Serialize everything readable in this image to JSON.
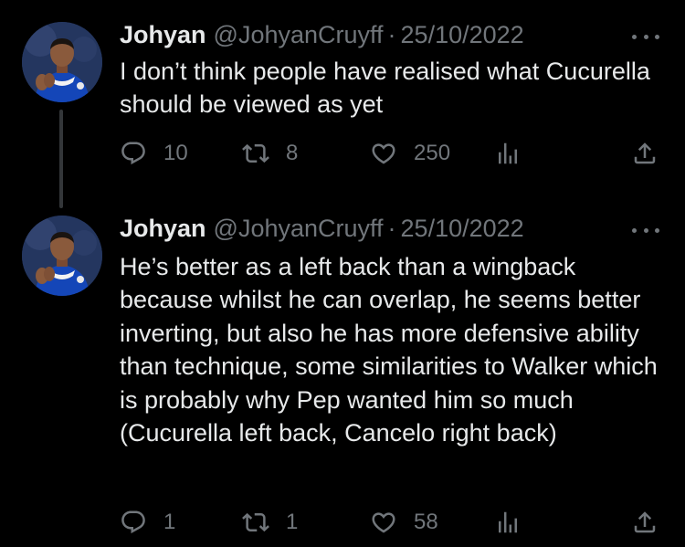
{
  "colors": {
    "background": "#000000",
    "text_primary": "#e7e9ea",
    "text_secondary": "#71767b",
    "thread_line": "#333639"
  },
  "icons": {
    "reply": "reply-icon",
    "retweet": "retweet-icon",
    "like": "heart-icon",
    "views": "analytics-icon",
    "share": "share-icon",
    "more": "more-icon"
  },
  "tweets": [
    {
      "name": "Johyan",
      "handle": "@JohyanCruyff",
      "separator": "·",
      "date": "25/10/2022",
      "text": "I don’t think people have realised what Cucurella should be viewed as yet",
      "replies": "10",
      "retweets": "8",
      "likes": "250"
    },
    {
      "name": "Johyan",
      "handle": "@JohyanCruyff",
      "separator": "·",
      "date": "25/10/2022",
      "text": "He’s better as a left back than a wingback because whilst he can overlap, he seems better inverting, but also he has more defensive ability than technique, some similarities to Walker which is probably why Pep wanted him so much (Cucurella left back, Cancelo right back)",
      "replies": "1",
      "retweets": "1",
      "likes": "58"
    }
  ]
}
